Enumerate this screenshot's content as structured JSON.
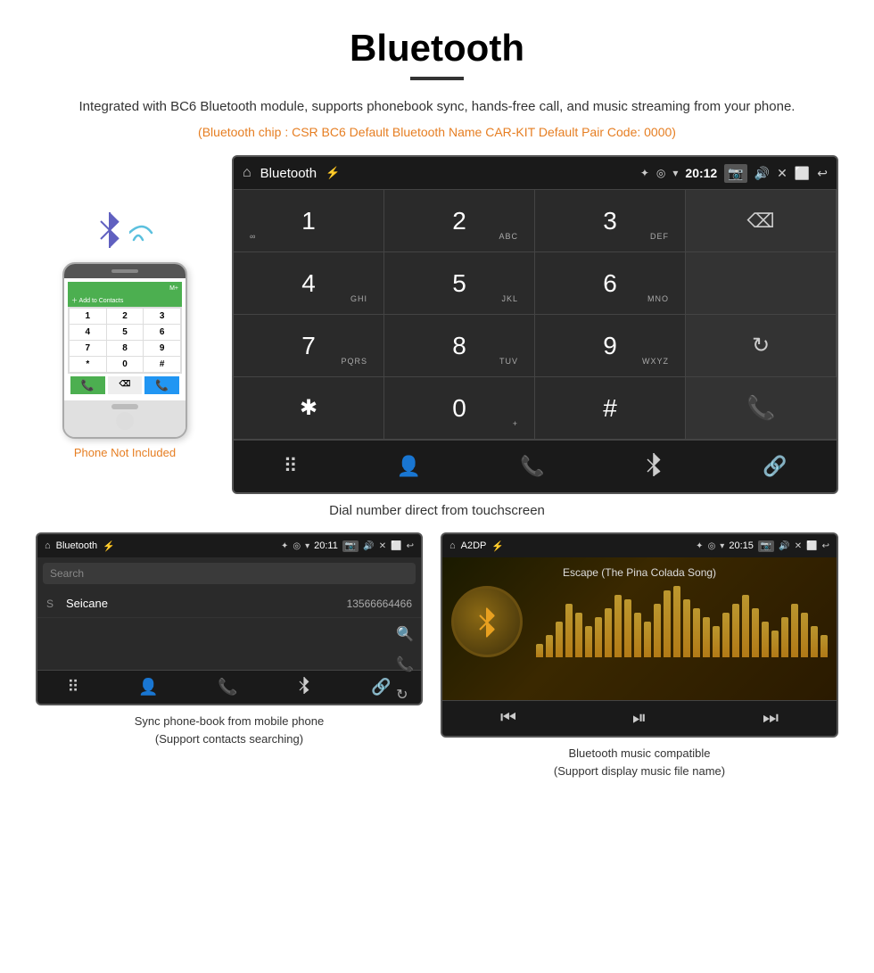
{
  "header": {
    "title": "Bluetooth",
    "description": "Integrated with BC6 Bluetooth module, supports phonebook sync, hands-free call, and music streaming from your phone.",
    "specs": "(Bluetooth chip : CSR BC6    Default Bluetooth Name CAR-KIT    Default Pair Code: 0000)",
    "phone_label": "Phone Not Included"
  },
  "main_screen": {
    "status_bar": {
      "title": "Bluetooth",
      "time": "20:12"
    },
    "dialpad": {
      "keys": [
        {
          "number": "1",
          "sub": "∞",
          "sub_pos": "left"
        },
        {
          "number": "2",
          "sub": "ABC"
        },
        {
          "number": "3",
          "sub": "DEF"
        },
        {
          "number": "4",
          "sub": "GHI"
        },
        {
          "number": "5",
          "sub": "JKL"
        },
        {
          "number": "6",
          "sub": "MNO"
        },
        {
          "number": "7",
          "sub": "PQRS"
        },
        {
          "number": "8",
          "sub": "TUV"
        },
        {
          "number": "9",
          "sub": "WXYZ"
        },
        {
          "number": "*",
          "sub": ""
        },
        {
          "number": "0",
          "sub": "+"
        },
        {
          "number": "#",
          "sub": ""
        }
      ]
    },
    "caption": "Dial number direct from touchscreen"
  },
  "phonebook_screen": {
    "status_bar": {
      "title": "Bluetooth",
      "time": "20:11"
    },
    "search_placeholder": "Search",
    "contact": {
      "letter": "S",
      "name": "Seicane",
      "number": "13566664466"
    },
    "caption": "Sync phone-book from mobile phone\n(Support contacts searching)"
  },
  "music_screen": {
    "status_bar": {
      "title": "A2DP",
      "time": "20:15"
    },
    "song_title": "Escape (The Pina Colada Song)",
    "eq_bars": [
      15,
      25,
      40,
      60,
      50,
      35,
      45,
      55,
      70,
      65,
      50,
      40,
      60,
      75,
      80,
      65,
      55,
      45,
      35,
      50,
      60,
      70,
      55,
      40,
      30,
      45,
      60,
      50,
      35,
      25
    ],
    "caption": "Bluetooth music compatible\n(Support display music file name)"
  }
}
